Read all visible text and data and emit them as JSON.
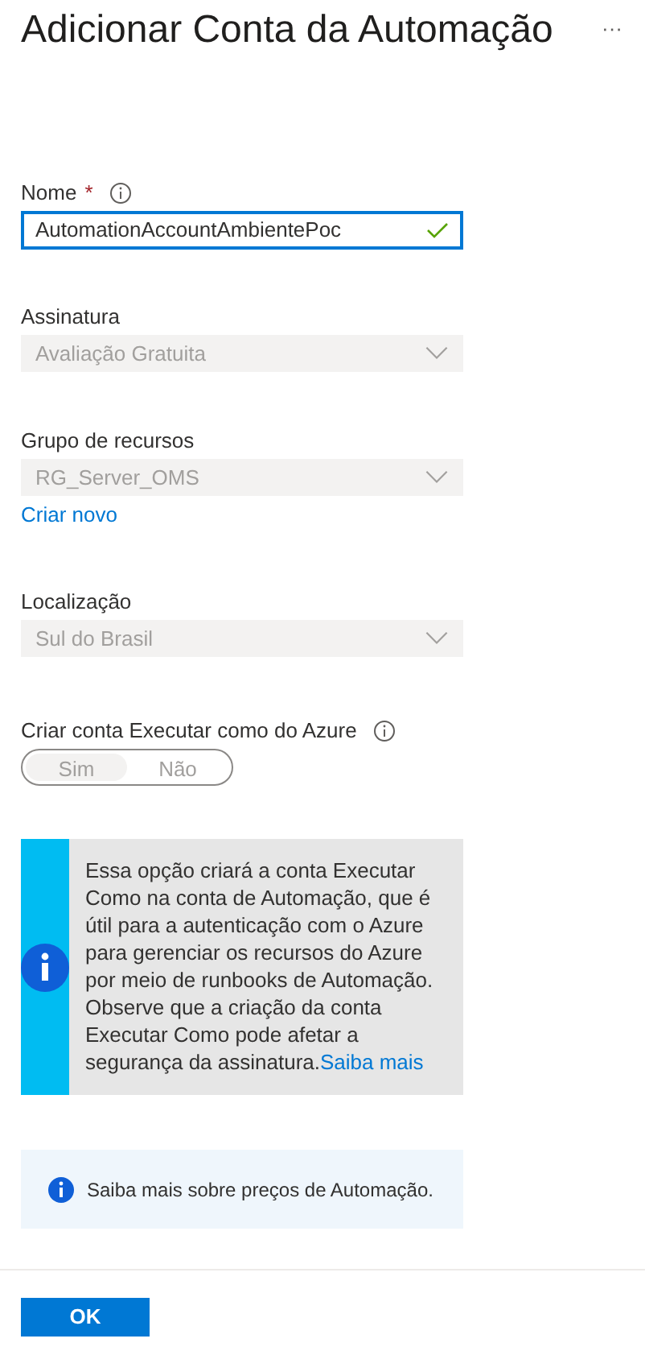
{
  "title": "Adicionar Conta da Automação",
  "more_button": "···",
  "fields": [
    {
      "kind": "text",
      "label": "Nome",
      "required": true,
      "info": true,
      "value": "AutomationAccountAmbientePoc",
      "valid": true
    },
    {
      "kind": "select",
      "label": "Assinatura",
      "value": "Avaliação Gratuita",
      "disabled": true
    },
    {
      "kind": "select",
      "label": "Grupo de recursos",
      "value": "RG_Server_OMS",
      "disabled": true,
      "link": "Criar novo"
    },
    {
      "kind": "select",
      "label": "Localização",
      "value": "Sul do Brasil",
      "disabled": true
    },
    {
      "kind": "toggle",
      "label": "Criar conta Executar como do Azure",
      "info": true,
      "disabled": true,
      "options": [
        {
          "label": "Sim",
          "selected": true
        },
        {
          "label": "Não",
          "selected": false
        }
      ]
    }
  ],
  "info_box": {
    "text": "Essa opção criará a conta Executar Como na conta de Automação, que é útil para a autenticação com o Azure para gerenciar os recursos do Azure por meio de runbooks de Automação. Observe que a criação da conta Executar Como pode afetar a segurança da assinatura.",
    "link": "Saiba mais"
  },
  "pricing_note": "Saiba mais sobre preços de Automação.",
  "ok_button": "OK",
  "required_mark": "*"
}
